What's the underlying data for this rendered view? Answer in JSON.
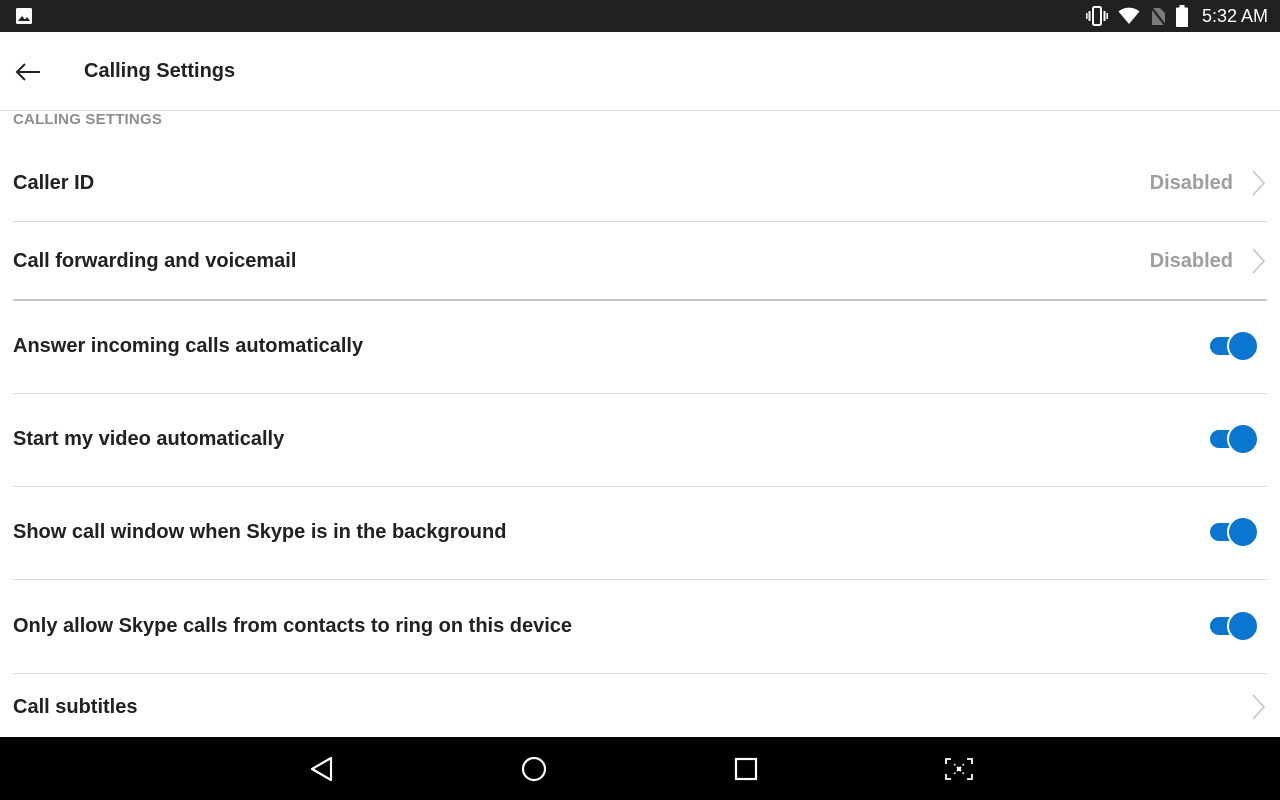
{
  "status_bar": {
    "time": "5:32 AM",
    "icons": [
      "image-notification-icon",
      "vibrate-icon",
      "wifi-icon",
      "no-sim-icon",
      "battery-icon"
    ]
  },
  "app_bar": {
    "title": "Calling Settings",
    "back_icon": "arrow-left-icon"
  },
  "section": {
    "header": "CALLING SETTINGS"
  },
  "rows": [
    {
      "label": "Caller ID",
      "value": "Disabled",
      "type": "link"
    },
    {
      "label": "Call forwarding and voicemail",
      "value": "Disabled",
      "type": "link"
    },
    {
      "label": "Answer incoming calls automatically",
      "type": "toggle",
      "on": true
    },
    {
      "label": "Start my video automatically",
      "type": "toggle",
      "on": true
    },
    {
      "label": "Show call window when Skype is in the background",
      "type": "toggle",
      "on": true
    },
    {
      "label": "Only allow Skype calls from contacts to ring on this device",
      "type": "toggle",
      "on": true
    },
    {
      "label": "Call subtitles",
      "type": "link"
    }
  ],
  "colors": {
    "accent": "#0b76d0",
    "status_bar": "#212121",
    "nav_bar": "#000000",
    "secondary_text": "#9e9e9e"
  },
  "nav_bar": {
    "buttons": [
      "back-triangle-icon",
      "home-circle-icon",
      "recents-square-icon",
      "screenshot-icon"
    ]
  }
}
